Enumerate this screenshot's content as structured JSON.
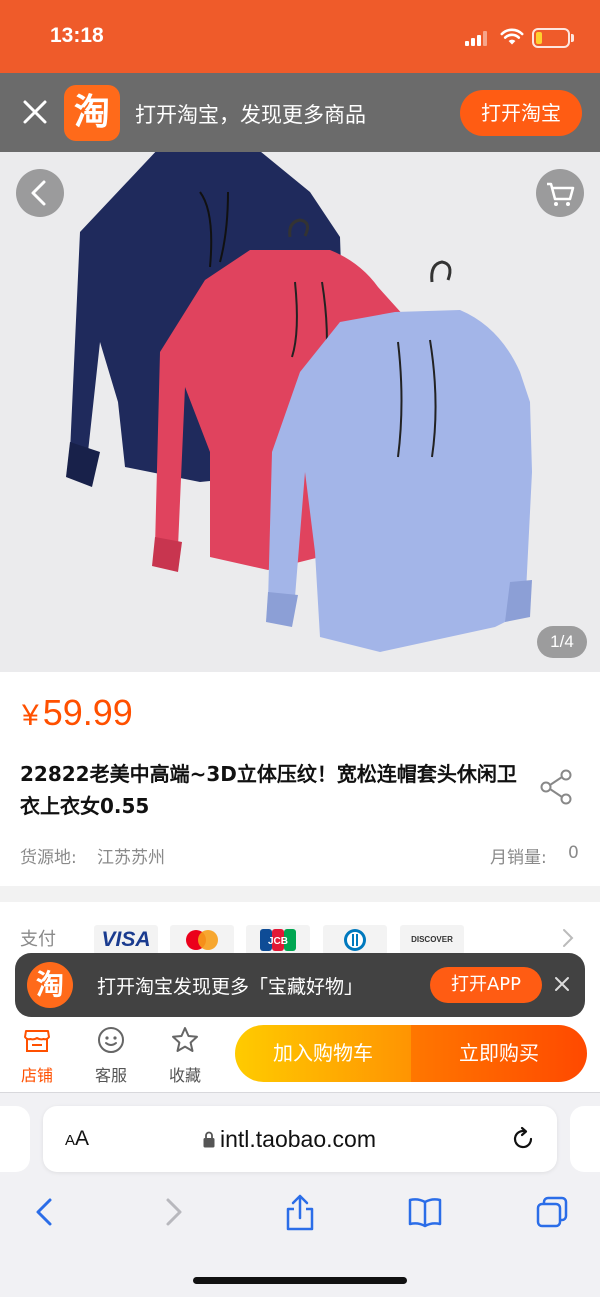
{
  "status_bar": {
    "time": "13:18",
    "battery_level": 0.2,
    "battery_color": "#ffd12e"
  },
  "app_banner": {
    "logo_char": "淘",
    "text": "打开淘宝，发现更多商品",
    "button_label": "打开淘宝",
    "close_icon": "close-icon"
  },
  "product_image": {
    "counter": "1/4",
    "back_icon": "chevron-left-icon",
    "cart_icon": "cart-icon",
    "hoodie_colors": [
      "#1f2a5c",
      "#e0435e",
      "#9fb2e6"
    ]
  },
  "product": {
    "price_currency": "¥",
    "price_value": "59.99",
    "title": "22822老美中高端~3D立体压纹！宽松连帽套头休闲卫衣上衣女0.55",
    "origin_label": "货源地:",
    "origin_value": "江苏苏州",
    "sales_label": "月销量:",
    "sales_value": "0"
  },
  "payment": {
    "label": "支付",
    "methods": [
      "VISA",
      "Mastercard",
      "JCB",
      "Diners Club",
      "DISCOVER"
    ]
  },
  "toast": {
    "logo_char": "淘",
    "text": "打开淘宝发现更多「宝藏好物」",
    "button_label": "打开APP"
  },
  "action_bar": {
    "store_label": "店铺",
    "service_label": "客服",
    "favorite_label": "收藏",
    "add_to_cart_label": "加入购物车",
    "buy_now_label": "立即购买"
  },
  "browser": {
    "aa_label_small": "A",
    "aa_label_large": "A",
    "url": "intl.taobao.com"
  },
  "colors": {
    "brand_orange": "#ef5b2a",
    "price_orange": "#ff5000",
    "cart_yellow": "#ffcb00",
    "buy_orange": "#ff4900",
    "safari_blue": "#2b6de8"
  }
}
